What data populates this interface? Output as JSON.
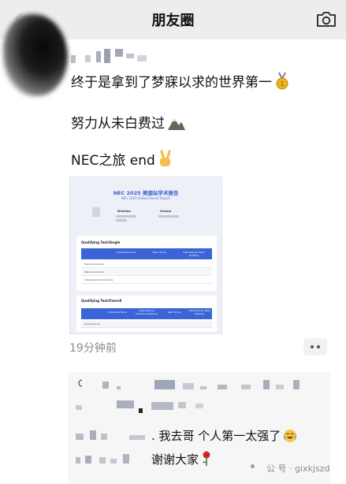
{
  "header": {
    "title": "朋友圈",
    "back_icon": "chevron-left-icon",
    "camera_icon": "camera-icon"
  },
  "post": {
    "line1": "终于是拿到了梦寐以求的世界第一",
    "line1_emoji": "gold-medal-icon",
    "line2": "努力从未白费过",
    "line2_emoji": "mountain-icon",
    "line3": "NEC之旅 end",
    "line3_emoji": "victory-hand-icon",
    "time": "19分钟前"
  },
  "attachment": {
    "title": "NEC 2025 美国站学术报告",
    "subtitle": "NEC 2025 Global Round Report",
    "division_label": "Division",
    "school_label": "School",
    "section1": "Qualifying Test/Single",
    "section2": "Qualifying Test/Overall",
    "table1_headers": [
      "Individual Score",
      "Team Score",
      "International Team Ranking"
    ],
    "table1_rows": [
      "Macroeconomics",
      "Macroeconomics",
      "International Economics"
    ],
    "table2_headers": [
      "Individual Score",
      "International Individual Ranking",
      "Team Score",
      "International Team Ranking"
    ],
    "table2_rows": [
      "Overall Score"
    ],
    "colors": {
      "accent": "#3b64d8",
      "background": "#eef0f8"
    }
  },
  "comments": {
    "comment1_text": ". 我去哥 个人第一太强了",
    "comment1_emoji": "crying-laughing-icon",
    "comment2_text": "谢谢大家",
    "comment2_emoji": "rose-icon"
  },
  "watermark": {
    "text": "公 号 · gixkjszd"
  }
}
